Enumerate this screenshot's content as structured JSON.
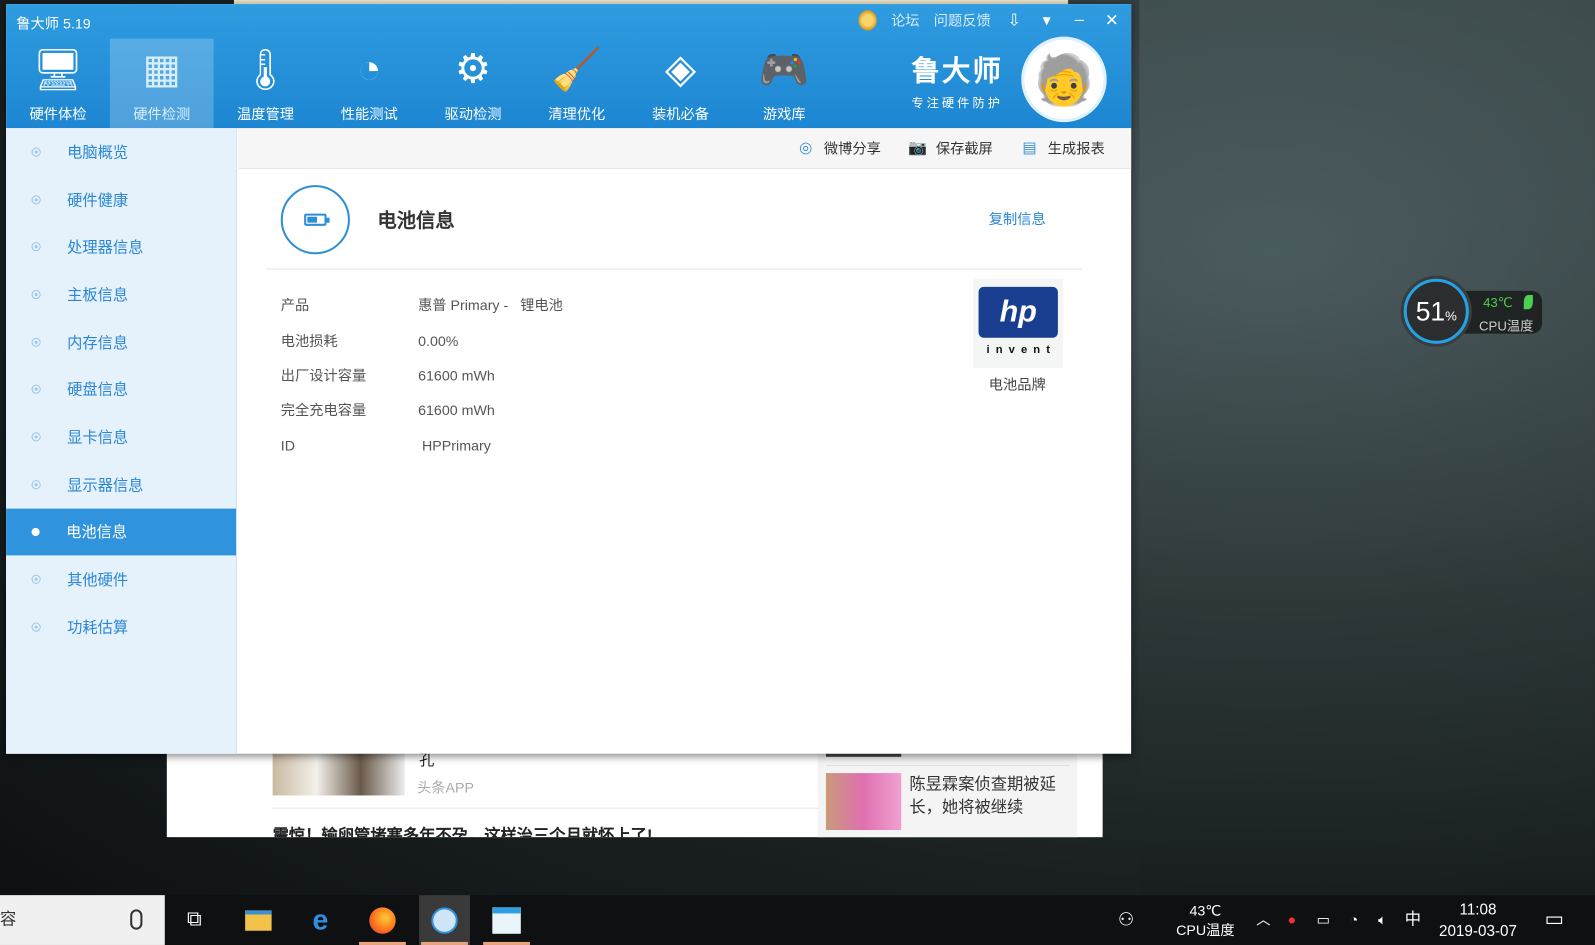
{
  "app": {
    "title": "鲁大师 5.19",
    "top_links": [
      "论坛",
      "问题反馈"
    ],
    "nav": [
      {
        "label": "硬件体检",
        "icon": "monitor-icon"
      },
      {
        "label": "硬件检测",
        "icon": "circuit-board-icon"
      },
      {
        "label": "温度管理",
        "icon": "thermometer-icon"
      },
      {
        "label": "性能测试",
        "icon": "speedometer-icon"
      },
      {
        "label": "驱动检测",
        "icon": "gear-icon"
      },
      {
        "label": "清理优化",
        "icon": "broom-icon"
      },
      {
        "label": "装机必备",
        "icon": "cube-icon"
      },
      {
        "label": "游戏库",
        "icon": "gamepad-icon"
      }
    ],
    "brand": {
      "name": "鲁大师",
      "slogan": "专注硬件防护"
    }
  },
  "sidebar": {
    "items": [
      "电脑概览",
      "硬件健康",
      "处理器信息",
      "主板信息",
      "内存信息",
      "硬盘信息",
      "显卡信息",
      "显示器信息",
      "电池信息",
      "其他硬件",
      "功耗估算"
    ],
    "active_index": 8
  },
  "toolbar": {
    "weibo": "微博分享",
    "screenshot": "保存截屏",
    "report": "生成报表"
  },
  "battery": {
    "title": "电池信息",
    "copy": "复制信息",
    "rows": [
      {
        "k": "产品",
        "v": "惠普 Primary -   锂电池"
      },
      {
        "k": "电池损耗",
        "v": "0.00%"
      },
      {
        "k": "出厂设计容量",
        "v": "61600 mWh"
      },
      {
        "k": "完全充电容量",
        "v": "61600 mWh"
      },
      {
        "k": "ID",
        "v": " HPPrimary"
      }
    ],
    "brand_logo": "hp invent",
    "brand_label": "电池品牌"
  },
  "background_page": {
    "headline_tail": "孔",
    "source": "头条APP",
    "headline2": "震惊！输卵管堵塞多年不孕，这样治三个月就怀上了!",
    "side_news": "陈昱霖案侦查期被延长，她将被继续"
  },
  "widget": {
    "percent": "51",
    "percent_sign": "%",
    "temp": "43℃",
    "label": "CPU温度"
  },
  "taskbar": {
    "search_text": "容",
    "cpu_temp": "43℃",
    "cpu_label": "CPU温度",
    "ime": "中",
    "time": "11:08",
    "date": "2019-03-07"
  },
  "colors": {
    "accent": "#2f93dd",
    "titlebar": "#1d86d2"
  }
}
